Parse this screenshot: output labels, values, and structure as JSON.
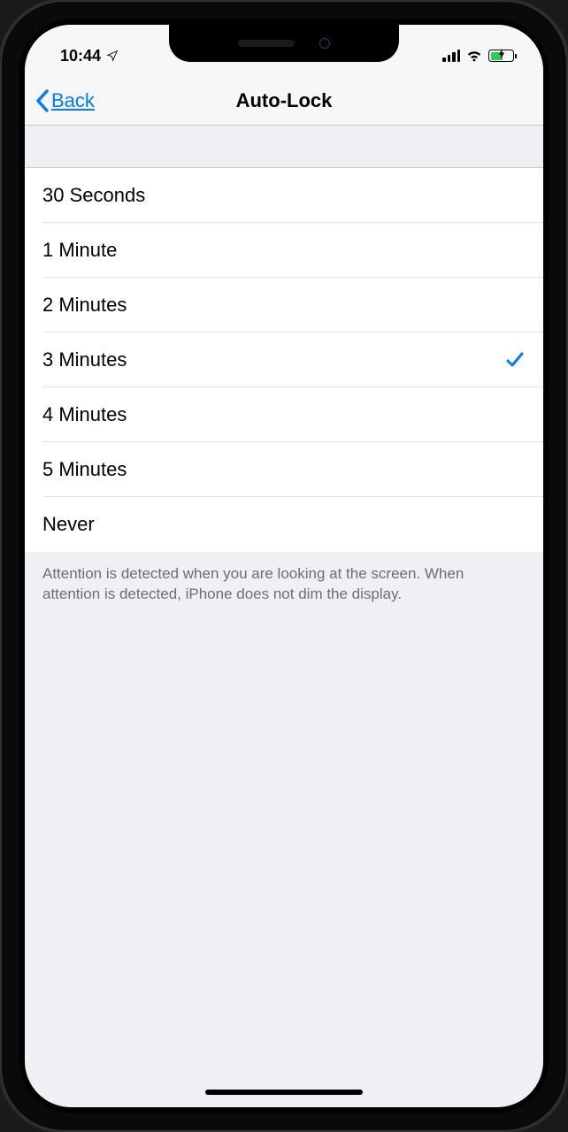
{
  "status_bar": {
    "time": "10:44"
  },
  "nav": {
    "back_label": "Back",
    "title": "Auto-Lock"
  },
  "options": [
    {
      "label": "30 Seconds",
      "selected": false
    },
    {
      "label": "1 Minute",
      "selected": false
    },
    {
      "label": "2 Minutes",
      "selected": false
    },
    {
      "label": "3 Minutes",
      "selected": true
    },
    {
      "label": "4 Minutes",
      "selected": false
    },
    {
      "label": "5 Minutes",
      "selected": false
    },
    {
      "label": "Never",
      "selected": false
    }
  ],
  "footer_text": "Attention is detected when you are looking at the screen. When attention is detected, iPhone does not dim the display."
}
